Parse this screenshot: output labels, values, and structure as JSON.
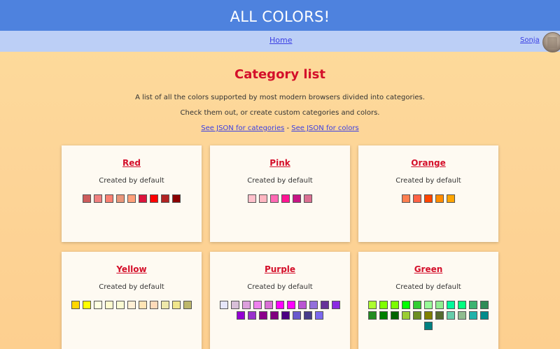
{
  "header": {
    "title": "ALL COLORS!"
  },
  "nav": {
    "home": "Home",
    "user": "Sonja"
  },
  "page": {
    "title": "Category list",
    "intro1": "A list of all the colors supported by most modern browsers divided into categories.",
    "intro2": "Check them out, or create custom categories and colors.",
    "link_categories": "See JSON for categories",
    "link_separator": " - ",
    "link_colors": "See JSON for colors"
  },
  "categories": [
    {
      "name": "Red",
      "subtitle": "Created by default",
      "colors": [
        "#cd5c5c",
        "#f08080",
        "#fa8072",
        "#e9967a",
        "#ffa07a",
        "#dc143c",
        "#ff0000",
        "#b22222",
        "#8b0000"
      ]
    },
    {
      "name": "Pink",
      "subtitle": "Created by default",
      "colors": [
        "#ffc0cb",
        "#ffb6c1",
        "#ff69b4",
        "#ff1493",
        "#c71585",
        "#db7093"
      ]
    },
    {
      "name": "Orange",
      "subtitle": "Created by default",
      "colors": [
        "#ff7f50",
        "#ff6347",
        "#ff4500",
        "#ff8c00",
        "#ffa500"
      ]
    },
    {
      "name": "Yellow",
      "subtitle": "Created by default",
      "colors": [
        "#ffd700",
        "#ffff00",
        "#ffffe0",
        "#fffacd",
        "#fafad2",
        "#ffefd5",
        "#ffe4b5",
        "#ffdab9",
        "#eee8aa",
        "#f0e68c",
        "#bdb76b"
      ]
    },
    {
      "name": "Purple",
      "subtitle": "Created by default",
      "colors": [
        "#e6e6fa",
        "#d8bfd8",
        "#dda0dd",
        "#ee82ee",
        "#da70d6",
        "#ff00ff",
        "#ff00ff",
        "#ba55d3",
        "#9370db",
        "#663399",
        "#8a2be2",
        "#9400d3",
        "#9932cc",
        "#8b008b",
        "#800080",
        "#4b0082",
        "#6a5acd",
        "#483d8b",
        "#7b68ee"
      ]
    },
    {
      "name": "Green",
      "subtitle": "Created by default",
      "colors": [
        "#adff2f",
        "#7fff00",
        "#7cfc00",
        "#00ff00",
        "#32cd32",
        "#98fb98",
        "#90ee90",
        "#00fa9a",
        "#00ff7f",
        "#3cb371",
        "#2e8b57",
        "#228b22",
        "#008000",
        "#006400",
        "#9acd32",
        "#6b8e23",
        "#808000",
        "#556b2f",
        "#66cdaa",
        "#8fbc8f",
        "#20b2aa",
        "#008b8b",
        "#008080"
      ]
    }
  ]
}
